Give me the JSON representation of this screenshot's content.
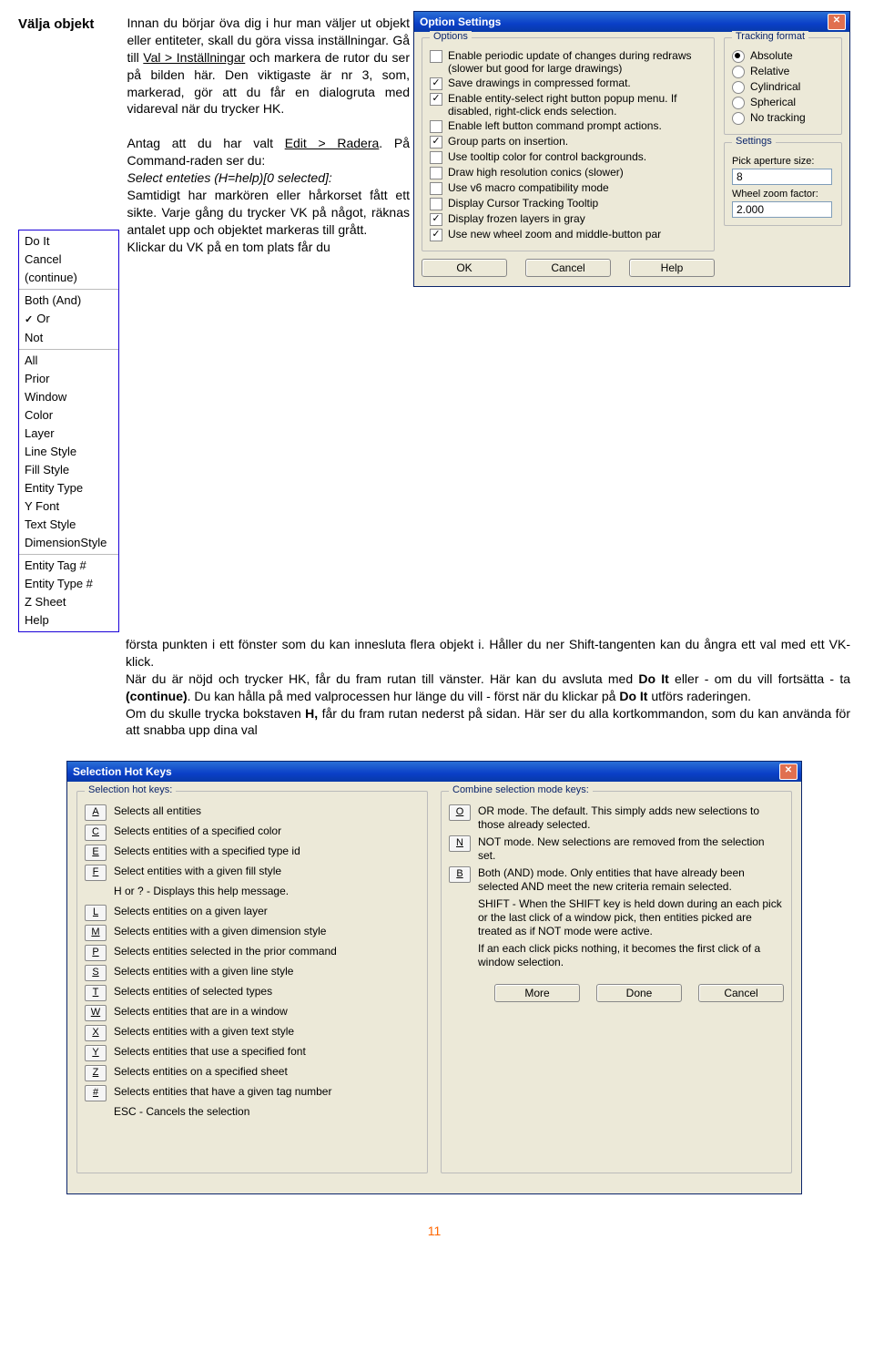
{
  "section_title": "Välja objekt",
  "para1": "Innan du börjar öva dig i hur man väljer ut objekt eller entiteter, skall du göra vissa inställningar. Gå till ",
  "para1_link": "Val > Inställningar",
  "para1_cont": " och markera de rutor du ser på bilden här. Den viktigaste är nr 3, som, markerad, gör att du får en dialogruta med vidareval när du trycker HK.",
  "para2a": "Antag att du har valt ",
  "para2_link": "Edit > Radera",
  "para2b": ". På Command-raden ser du:",
  "para2_cmd": "Select enteties (H=help)[0 selected]:",
  "para2c": "Samtidigt har markören eller hårkorset fått ett sikte. Varje gång du trycker VK på något, räknas antalet upp och objektet markeras till grått.",
  "para2d": "Klickar du VK på en tom plats får du",
  "body1": "första punkten i ett fönster som du kan innesluta flera objekt i.  Håller du ner Shift-tangenten kan du ångra ett val med ett VK-klick.",
  "body2a": "När du är nöjd och trycker HK, får du fram rutan till vänster. Här kan du avsluta med ",
  "body2b": "Do It",
  "body2c": " eller - om du vill fortsätta - ta ",
  "body2d": "(continue)",
  "body2e": ". Du kan hålla på med valprocessen hur länge du vill - först när du klickar på ",
  "body2f": "Do It",
  "body2g": " utförs raderingen.",
  "body3a": "Om du skulle trycka bokstaven ",
  "body3b": "H,",
  "body3c": " får du fram rutan nederst på sidan. Här ser du alla kortkommandon, som du kan använda för att snabba upp dina val",
  "menu": {
    "g1": [
      "Do It",
      "Cancel",
      "(continue)"
    ],
    "g2": [
      "Both (And)",
      "Or",
      "Not"
    ],
    "g3": [
      "All",
      "Prior",
      "Window",
      "Color",
      "Layer",
      "Line Style",
      "Fill Style",
      "Entity Type",
      "Y Font",
      "Text Style",
      "DimensionStyle"
    ],
    "g4": [
      "Entity Tag #",
      "Entity Type #",
      "Z Sheet",
      "Help"
    ],
    "checked": "Or"
  },
  "dialog1": {
    "title": "Option Settings",
    "options_legend": "Options",
    "opts": [
      {
        "label": "Enable periodic update of changes during redraws (slower but good for large drawings)",
        "checked": false
      },
      {
        "label": "Save drawings in compressed format.",
        "checked": true
      },
      {
        "label": "Enable entity-select right button popup menu. If disabled, right-click ends selection.",
        "checked": true
      },
      {
        "label": "Enable left button command prompt actions.",
        "checked": false
      },
      {
        "label": "Group parts on insertion.",
        "checked": true
      },
      {
        "label": "Use tooltip color for control backgrounds.",
        "checked": false
      },
      {
        "label": "Draw high resolution conics (slower)",
        "checked": false
      },
      {
        "label": "Use v6 macro compatibility mode",
        "checked": false
      },
      {
        "label": "Display Cursor Tracking Tooltip",
        "checked": false
      },
      {
        "label": "Display frozen layers in gray",
        "checked": true
      },
      {
        "label": "Use new wheel zoom and middle-button par",
        "checked": true
      }
    ],
    "track_legend": "Tracking format",
    "track": [
      {
        "label": "Absolute",
        "sel": true
      },
      {
        "label": "Relative",
        "sel": false
      },
      {
        "label": "Cylindrical",
        "sel": false
      },
      {
        "label": "Spherical",
        "sel": false
      },
      {
        "label": "No tracking",
        "sel": false
      }
    ],
    "settings_legend": "Settings",
    "pick_label": "Pick aperture size:",
    "pick_value": "8",
    "wheel_label": "Wheel zoom factor:",
    "wheel_value": "2.000",
    "btn_ok": "OK",
    "btn_cancel": "Cancel",
    "btn_help": "Help"
  },
  "dialog2": {
    "title": "Selection Hot Keys",
    "left_legend": "Selection hot keys:",
    "left": [
      {
        "key": "A",
        "label": "Selects all entities"
      },
      {
        "key": "C",
        "label": "Selects entities of a specified color"
      },
      {
        "key": "E",
        "label": "Selects entities with a specified type id"
      },
      {
        "key": "F",
        "label": "Select entities with a given fill style"
      },
      {
        "key": "",
        "label": "H or ? - Displays this help message."
      },
      {
        "key": "L",
        "label": "Selects entities on a given layer"
      },
      {
        "key": "M",
        "label": "Selects entities with a given dimension style"
      },
      {
        "key": "P",
        "label": "Selects entities selected in the prior command"
      },
      {
        "key": "S",
        "label": "Selects entities with a given line style"
      },
      {
        "key": "T",
        "label": "Selects entities of selected types"
      },
      {
        "key": "W",
        "label": "Selects entities that are in a window"
      },
      {
        "key": "X",
        "label": "Selects entities with a given text style"
      },
      {
        "key": "Y",
        "label": "Selects entities that use a specified font"
      },
      {
        "key": "Z",
        "label": "Selects entities on a specified sheet"
      },
      {
        "key": "#",
        "label": "Selects entities that have a given tag number"
      },
      {
        "key": "",
        "label": "ESC - Cancels the selection"
      }
    ],
    "right_legend": "Combine selection mode keys:",
    "right": [
      {
        "key": "O",
        "label": "OR mode. The default. This simply adds new selections to those already selected."
      },
      {
        "key": "N",
        "label": "NOT mode. New selections are removed from the selection set."
      },
      {
        "key": "B",
        "label": "Both (AND) mode. Only entities that have already been selected AND meet the new criteria remain selected."
      },
      {
        "key": "",
        "label": "SHIFT - When the SHIFT key is held down during an each pick or the last click of a window pick, then entities picked are treated as if NOT mode were active."
      },
      {
        "key": "",
        "label": "If an each click picks nothing, it becomes the first click of a window selection."
      }
    ],
    "btn_more": "More",
    "btn_done": "Done",
    "btn_cancel": "Cancel"
  },
  "page_number": "11"
}
